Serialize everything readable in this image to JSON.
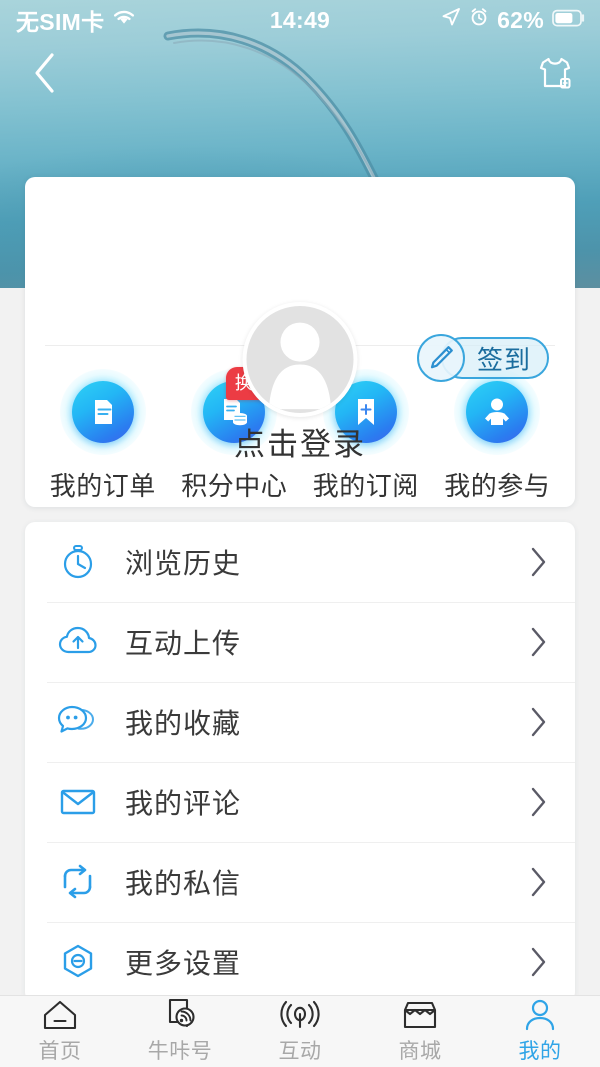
{
  "status_bar": {
    "carrier": "无SIM卡",
    "wifi_icon": "wifi-icon",
    "time": "14:49",
    "location_icon": "location-arrow-icon",
    "alarm_icon": "alarm-clock-icon",
    "battery_percent": "62%",
    "battery_icon": "battery-icon"
  },
  "nav": {
    "back_icon": "chevron-left-icon",
    "skin_icon": "tshirt-skin-icon"
  },
  "profile": {
    "avatar_icon": "default-avatar-icon",
    "login_label": "点击登录",
    "signin_label": "签到",
    "signin_icon": "pencil-icon"
  },
  "quick_actions": [
    {
      "label": "我的订单",
      "icon": "document-icon",
      "badge": null
    },
    {
      "label": "积分中心",
      "icon": "points-coins-icon",
      "badge": "换好礼"
    },
    {
      "label": "我的订阅",
      "icon": "bookmark-plus-icon",
      "badge": null
    },
    {
      "label": "我的参与",
      "icon": "person-icon",
      "badge": null
    }
  ],
  "menu_items": [
    {
      "label": "浏览历史",
      "icon": "stopwatch-icon",
      "chevron": "chevron-right-icon"
    },
    {
      "label": "互动上传",
      "icon": "cloud-upload-icon",
      "chevron": "chevron-right-icon"
    },
    {
      "label": "我的收藏",
      "icon": "chat-bubbles-icon",
      "chevron": "chevron-right-icon"
    },
    {
      "label": "我的评论",
      "icon": "envelope-icon",
      "chevron": "chevron-right-icon"
    },
    {
      "label": "我的私信",
      "icon": "swap-arrows-icon",
      "chevron": "chevron-right-icon"
    },
    {
      "label": "更多设置",
      "icon": "hexagon-settings-icon",
      "chevron": "chevron-right-icon"
    }
  ],
  "tab_bar": [
    {
      "label": "首页",
      "icon": "home-icon",
      "active": false
    },
    {
      "label": "牛咔号",
      "icon": "account-signal-icon",
      "active": false
    },
    {
      "label": "互动",
      "icon": "broadcast-icon",
      "active": false
    },
    {
      "label": "商城",
      "icon": "store-icon",
      "active": false
    },
    {
      "label": "我的",
      "icon": "user-icon",
      "active": true
    }
  ],
  "colors": {
    "accent": "#2fa4e7",
    "badge_red": "#ec3c44",
    "icon_blue": "#2b9ee8",
    "text_dark": "#333333",
    "tab_inactive": "#a8a8a8",
    "page_bg": "#f2f2f2"
  }
}
